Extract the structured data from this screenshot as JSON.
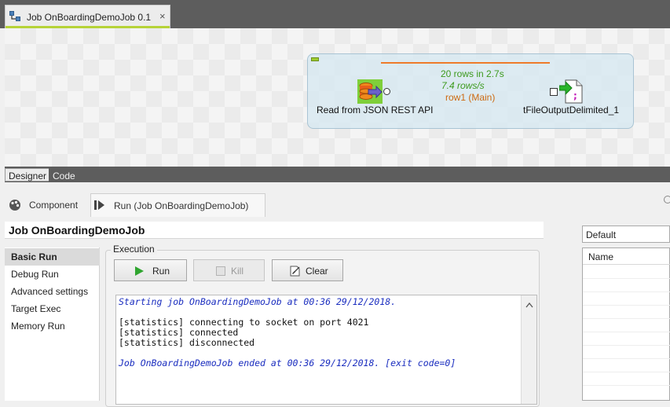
{
  "editor": {
    "tab_title": "Job OnBoardingDemoJob 0.1",
    "close_glyph": "×",
    "accent_color": "#b6d338"
  },
  "canvas": {
    "source_component": {
      "label": "Read from JSON REST API",
      "icon": "json-rest-input-icon"
    },
    "target_component": {
      "label": "tFileOutputDelimited_1",
      "icon": "file-output-delimited-icon"
    },
    "link": {
      "rows_stat": "20 rows in 2.7s",
      "rate_stat": "7.4 rows/s",
      "name": "row1 (Main)",
      "color": "#ee7b2a"
    },
    "bottom_tabs": [
      "Designer",
      "Code"
    ]
  },
  "panel": {
    "tabs": [
      {
        "label": "Component",
        "icon": "component-icon"
      },
      {
        "label": "Run (Job OnBoardingDemoJob)",
        "icon": "run-view-icon"
      }
    ],
    "job_title": "Job OnBoardingDemoJob",
    "menu": [
      "Basic Run",
      "Debug Run",
      "Advanced settings",
      "Target Exec",
      "Memory Run"
    ],
    "execution": {
      "legend": "Execution",
      "run_label": "Run",
      "kill_label": "Kill",
      "clear_label": "Clear"
    },
    "console_lines": [
      "Starting job OnBoardingDemoJob at 00:36 29/12/2018.",
      "[statistics] connecting to socket on port 4021",
      "[statistics] connected",
      "[statistics] disconnected",
      "Job OnBoardingDemoJob ended at 00:36 29/12/2018. [exit code=0]"
    ],
    "context_select": "Default",
    "context_table_header": "Name"
  }
}
